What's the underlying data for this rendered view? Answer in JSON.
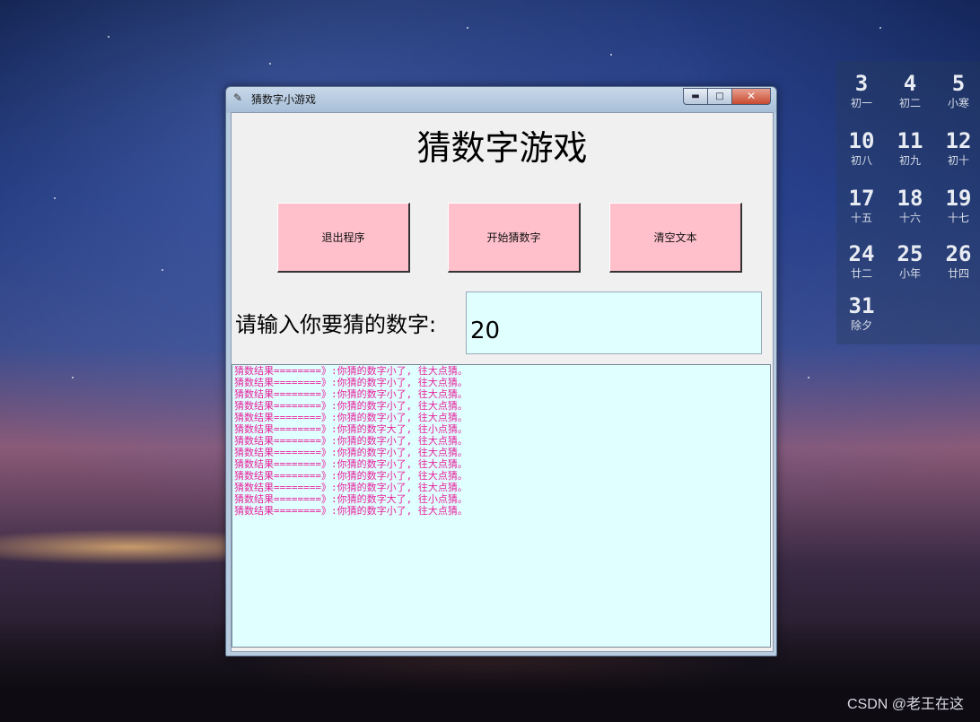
{
  "window": {
    "title": "猜数字小游戏",
    "minimize": "▬",
    "maximize": "□",
    "close": "✕"
  },
  "heading": "猜数字游戏",
  "buttons": {
    "exit": "退出程序",
    "start": "开始猜数字",
    "clear": "清空文本"
  },
  "prompt": "请输入你要猜的数字:",
  "input_value": "20",
  "log": [
    "猜数结果========》:你猜的数字小了, 往大点猜。",
    "猜数结果========》:你猜的数字小了, 往大点猜。",
    "猜数结果========》:你猜的数字小了, 往大点猜。",
    "猜数结果========》:你猜的数字小了, 往大点猜。",
    "猜数结果========》:你猜的数字小了, 往大点猜。",
    "猜数结果========》:你猜的数字大了, 往小点猜。",
    "猜数结果========》:你猜的数字小了, 往大点猜。",
    "猜数结果========》:你猜的数字小了, 往大点猜。",
    "猜数结果========》:你猜的数字小了, 往大点猜。",
    "猜数结果========》:你猜的数字小了, 往大点猜。",
    "猜数结果========》:你猜的数字小了, 往大点猜。",
    "猜数结果========》:你猜的数字大了, 往小点猜。",
    "猜数结果========》:你猜的数字小了, 往大点猜。"
  ],
  "calendar": [
    {
      "day": "3",
      "lunar": "初一"
    },
    {
      "day": "4",
      "lunar": "初二"
    },
    {
      "day": "5",
      "lunar": "小寒"
    },
    {
      "day": "10",
      "lunar": "初八"
    },
    {
      "day": "11",
      "lunar": "初九"
    },
    {
      "day": "12",
      "lunar": "初十"
    },
    {
      "day": "17",
      "lunar": "十五"
    },
    {
      "day": "18",
      "lunar": "十六"
    },
    {
      "day": "19",
      "lunar": "十七"
    },
    {
      "day": "24",
      "lunar": "廿二"
    },
    {
      "day": "25",
      "lunar": "小年"
    },
    {
      "day": "26",
      "lunar": "廿四"
    },
    {
      "day": "31",
      "lunar": "除夕"
    }
  ],
  "watermark": "CSDN @老王在这",
  "colors": {
    "button_bg": "#ffc0cb",
    "text_bg": "#e0ffff",
    "log_text": "#e8209a"
  }
}
